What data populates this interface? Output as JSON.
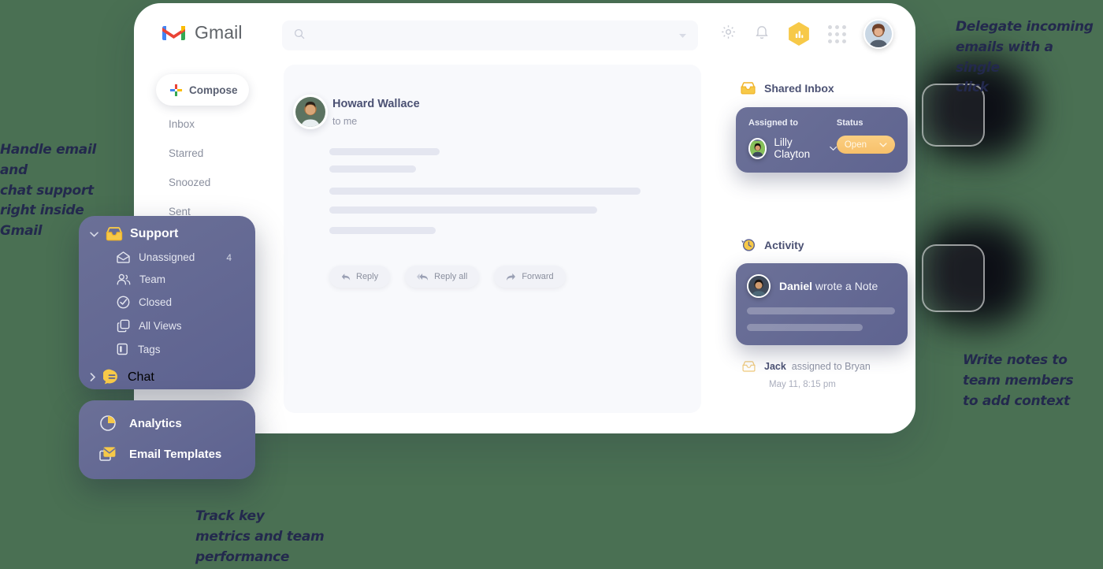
{
  "background_color": "#4a7053",
  "app": {
    "name": "Gmail",
    "logo_icon": "gmail-logo-icon"
  },
  "search": {
    "value": "",
    "placeholder": "",
    "icon": "search-icon",
    "caret_icon": "chevron-down-icon"
  },
  "topbar_icons": [
    {
      "name": "gear-icon",
      "label": "Settings"
    },
    {
      "name": "bell-icon",
      "label": "Notifications"
    },
    {
      "name": "analytics-hexagon-badge-icon",
      "label": "Analytics",
      "color": "#f7c948"
    },
    {
      "name": "apps-grid-icon",
      "label": "Google apps"
    },
    {
      "name": "avatar",
      "label": "Account"
    }
  ],
  "leftnav": {
    "compose": {
      "label": "Compose",
      "icon": "plus-icon"
    },
    "items": [
      {
        "label": "Inbox"
      },
      {
        "label": "Starred"
      },
      {
        "label": "Snoozed"
      },
      {
        "label": "Sent"
      }
    ]
  },
  "email": {
    "sender_name": "Howard Wallace",
    "recipient": "to me",
    "avatar": "sender-avatar",
    "body_skeleton_widths": [
      140,
      110,
      395,
      340,
      135
    ],
    "actions": [
      {
        "label": "Reply",
        "icon": "reply-icon"
      },
      {
        "label": "Reply all",
        "icon": "reply-all-icon"
      },
      {
        "label": "Forward",
        "icon": "forward-icon"
      }
    ]
  },
  "shared_inbox": {
    "title": "Shared Inbox",
    "icon": "inbox-tray-icon",
    "assigned_to_label": "Assigned to",
    "assignee_name": "Lilly Clayton",
    "assignee_caret": "chevron-down-icon",
    "status_label": "Status",
    "status_value": "Open",
    "status_color": "#f7c06a",
    "status_caret": "chevron-down-icon"
  },
  "activity": {
    "title": "Activity",
    "icon": "activity-clock-icon",
    "note": {
      "author": "Daniel",
      "text": " wrote a Note",
      "avatar": "daniel-avatar"
    },
    "entry": {
      "actor": "Jack",
      "text": "assigned to Bryan",
      "icon": "inbox-tray-icon",
      "date": "May 11, 8:15 pm"
    }
  },
  "support_menu": {
    "header": {
      "label": "Support",
      "icon": "inbox-tray-icon",
      "chevron": "chevron-down-icon"
    },
    "items": [
      {
        "label": "Unassigned",
        "icon": "open-envelope-icon",
        "count": "4"
      },
      {
        "label": "Team",
        "icon": "people-icon",
        "count": ""
      },
      {
        "label": "Closed",
        "icon": "check-circle-icon",
        "count": ""
      },
      {
        "label": "All Views",
        "icon": "copy-icon",
        "count": ""
      },
      {
        "label": "Tags",
        "icon": "tag-panel-icon",
        "count": ""
      }
    ],
    "footer": {
      "label": "Chat",
      "icon": "chat-bubble-icon",
      "chevron": "chevron-right-icon"
    }
  },
  "analytics_menu": {
    "items": [
      {
        "label": "Analytics",
        "icon": "pie-chart-icon"
      },
      {
        "label": "Email Templates",
        "icon": "envelope-icon"
      }
    ]
  },
  "annotations": {
    "left": "Handle email and\nchat support\nright inside Gmail",
    "top_right": "Delegate incoming\nemails with a single\nclick",
    "bottom_right": "Write notes to\nteam members\nto add context",
    "bottom": "Track key\nmetrics and team\nperformance"
  }
}
